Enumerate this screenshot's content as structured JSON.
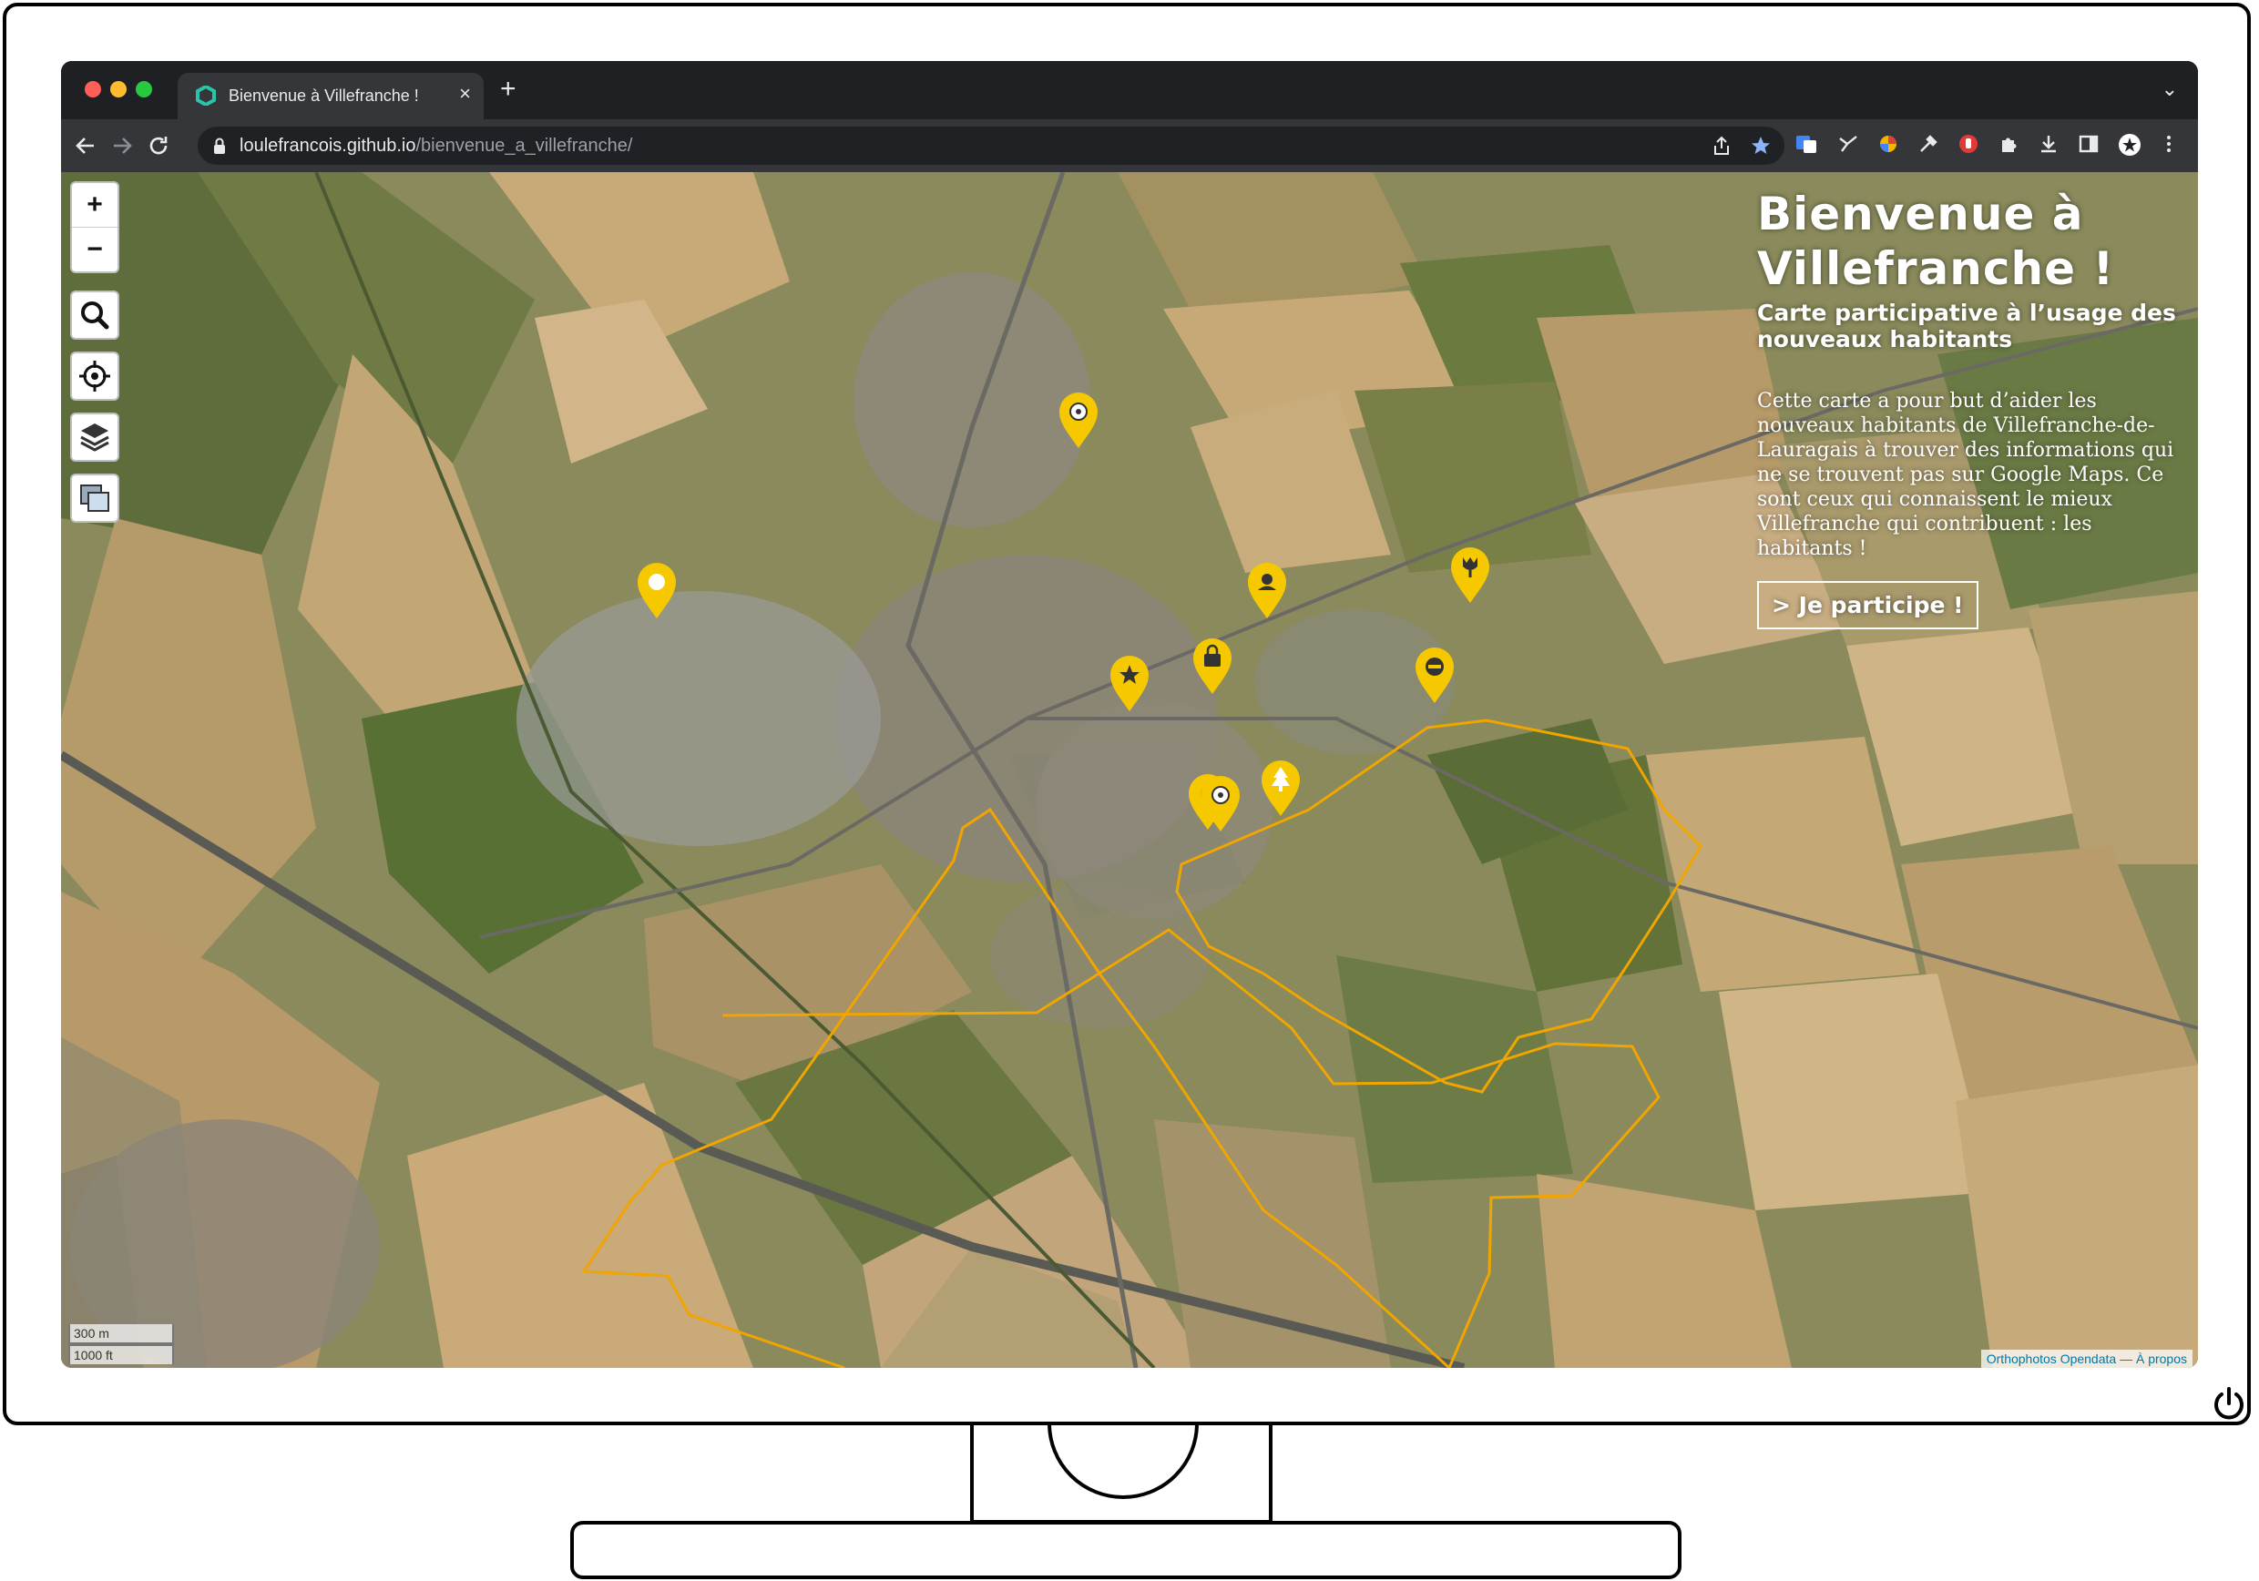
{
  "browser": {
    "tab_title": "Bienvenue à Villefranche !",
    "url_host": "loulefrancois.github.io",
    "url_path": "/bienvenue_a_villefranche/",
    "tab_close": "×",
    "new_tab": "+",
    "tab_dropdown": "⌄"
  },
  "map": {
    "zoom_in": "+",
    "zoom_out": "−",
    "scale_metric": "300 m",
    "scale_imperial": "1000 ft",
    "attribution": "Orthophotos Opendata — À propos",
    "marker_color": "#f5c800",
    "boundary_color": "#f0a500"
  },
  "overlay": {
    "title_line1": "Bienvenue à",
    "title_line2": "Villefranche !",
    "subtitle": "Carte participative à l’usage des nouveaux habitants",
    "body": "Cette carte a pour but d’aider les nouveaux habitants de Villefranche-de-Lauragais à trouver des informations qui ne se trouvent pas sur Google Maps. Ce sont ceux qui connaissent le mieux Villefranche qui contribuent : les habitants !",
    "cta": "> Je participe !"
  },
  "markers": [
    {
      "icon": "soccer-ball-icon"
    },
    {
      "icon": "pin-dot-icon"
    },
    {
      "icon": "person-icon"
    },
    {
      "icon": "tulip-icon"
    },
    {
      "icon": "bag-icon"
    },
    {
      "icon": "star-icon"
    },
    {
      "icon": "no-entry-icon"
    },
    {
      "icon": "tree-icon"
    },
    {
      "icon": "soccer-ball-icon"
    },
    {
      "icon": "generic-icon"
    }
  ]
}
